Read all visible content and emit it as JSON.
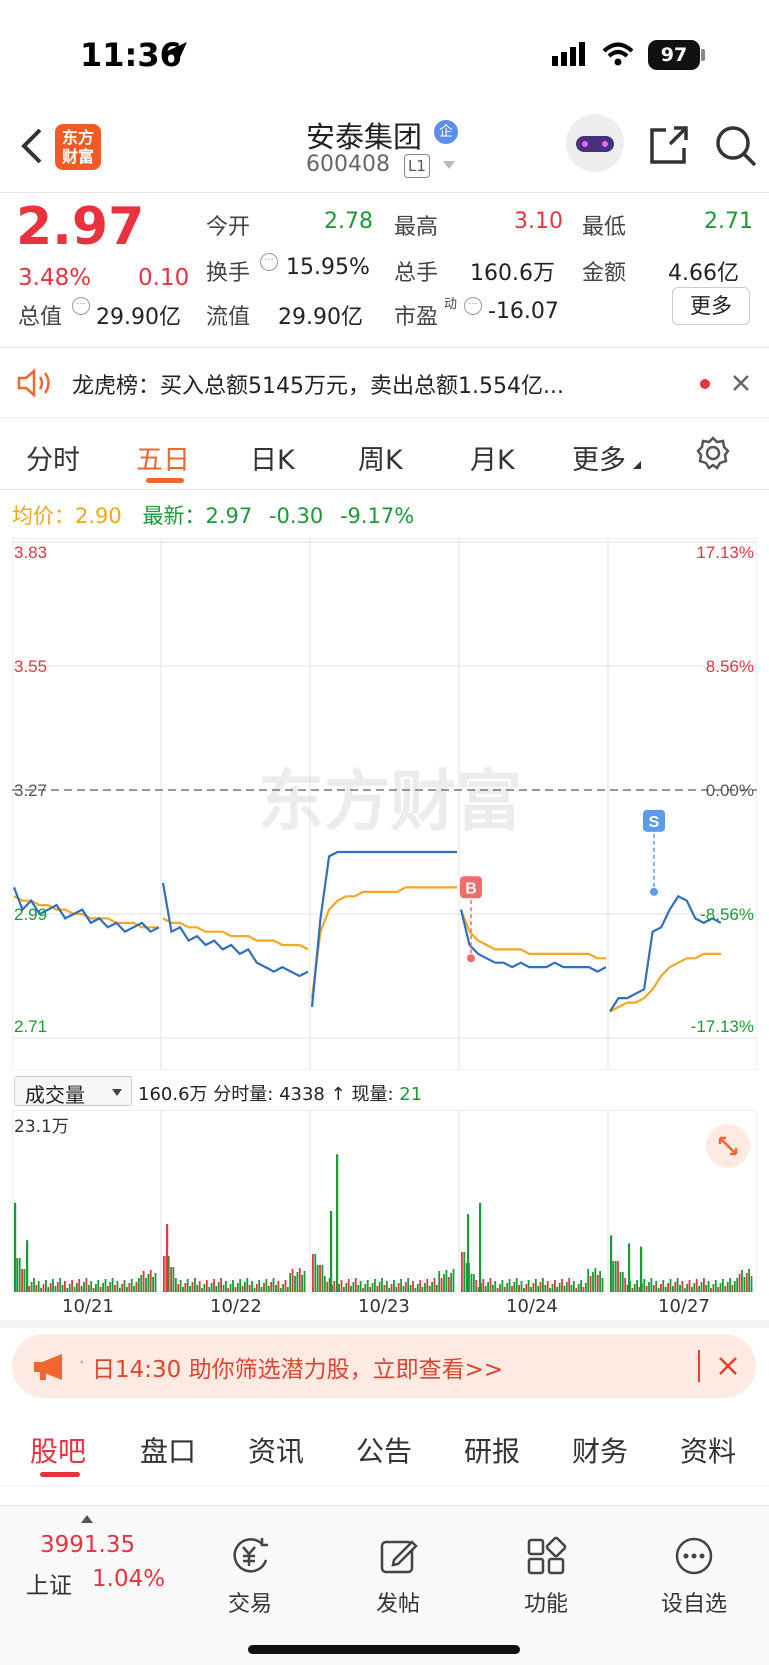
{
  "status": {
    "time": "11:36",
    "battery": "97"
  },
  "header": {
    "title": "安泰集团",
    "badge": "企",
    "code": "600408",
    "level": "L1",
    "logo_line1": "东方",
    "logo_line2": "财富"
  },
  "quote": {
    "price": "2.97",
    "change_pct": "3.48%",
    "change": "0.10",
    "fields": [
      {
        "label": "今开",
        "value": "2.78",
        "color": "green"
      },
      {
        "label": "最高",
        "value": "3.10",
        "color": "red"
      },
      {
        "label": "最低",
        "value": "2.71",
        "color": "green"
      },
      {
        "label": "换手",
        "value": "15.95%",
        "color": "black"
      },
      {
        "label": "总手",
        "value": "160.6万",
        "color": "black"
      },
      {
        "label": "金额",
        "value": "4.66亿",
        "color": "black"
      },
      {
        "label": "总值",
        "value": "29.90亿",
        "color": "black"
      },
      {
        "label": "流值",
        "value": "29.90亿",
        "color": "black"
      },
      {
        "label": "市盈",
        "value": "-16.07",
        "color": "black"
      }
    ],
    "pe_sup": "动",
    "more": "更多"
  },
  "notice": {
    "text": "龙虎榜：买入总额5145万元，卖出总额1.554亿..."
  },
  "tabs": [
    "分时",
    "五日",
    "日K",
    "周K",
    "月K",
    "更多"
  ],
  "active_tab": "五日",
  "info": {
    "avg_label": "均价：",
    "avg": "2.90",
    "latest_label": "最新：",
    "latest": "2.97",
    "chg": "-0.30",
    "chg_pct": "-9.17%"
  },
  "watermark": "东方财富",
  "volume": {
    "selector": "成交量",
    "total": "160.6万",
    "tick_label": "分时量:",
    "tick": "4338",
    "arrow": "↑",
    "now_label": "现量:",
    "now": "21",
    "max": "23.1万"
  },
  "banner": {
    "text": "日14:30 助你筛选潜力股，立即查看>>",
    "prefix": "·"
  },
  "bottom_tabs": [
    "股吧",
    "盘口",
    "资讯",
    "公告",
    "研报",
    "财务",
    "资料"
  ],
  "bottom_nav": {
    "index_value": "3991.35",
    "index_name": "上证",
    "index_pct": "1.04%",
    "items": [
      {
        "label": "交易",
        "icon": "trade-icon"
      },
      {
        "label": "发帖",
        "icon": "post-icon"
      },
      {
        "label": "功能",
        "icon": "apps-icon"
      },
      {
        "label": "设自选",
        "icon": "more-icon"
      }
    ]
  },
  "chart_data": {
    "type": "line",
    "x_labels": [
      "10/21",
      "10/22",
      "10/23",
      "10/24",
      "10/27"
    ],
    "y_left": [
      "3.83",
      "3.55",
      "3.27",
      "2.99",
      "2.71"
    ],
    "y_right": [
      "17.13%",
      "8.56%",
      "0.00%",
      "-8.56%",
      "-17.13%"
    ],
    "ylim": [
      2.71,
      3.83
    ],
    "prev_close": 3.27,
    "series": [
      {
        "name": "最新",
        "color": "#2f6fbf",
        "values": [
          [
            3.05,
            3.0,
            3.02,
            2.99,
            3.0,
            3.01,
            2.98,
            2.99,
            3.0,
            2.97,
            2.98,
            2.96,
            2.97,
            2.95,
            2.96,
            2.97,
            2.95,
            2.96
          ],
          [
            3.06,
            2.95,
            2.96,
            2.93,
            2.94,
            2.92,
            2.93,
            2.91,
            2.92,
            2.9,
            2.91,
            2.88,
            2.87,
            2.86,
            2.87,
            2.86,
            2.85,
            2.86
          ],
          [
            2.78,
            2.98,
            3.12,
            3.13,
            3.13,
            3.13,
            3.13,
            3.13,
            3.13,
            3.13,
            3.13,
            3.13,
            3.13,
            3.13,
            3.13,
            3.13,
            3.13,
            3.13
          ],
          [
            3.0,
            2.92,
            2.9,
            2.89,
            2.88,
            2.88,
            2.87,
            2.88,
            2.87,
            2.87,
            2.87,
            2.88,
            2.87,
            2.87,
            2.87,
            2.87,
            2.86,
            2.87
          ],
          [
            2.77,
            2.8,
            2.8,
            2.81,
            2.82,
            2.95,
            2.96,
            3.0,
            3.03,
            3.02,
            2.98,
            2.97,
            2.98,
            2.97
          ]
        ]
      },
      {
        "name": "均价",
        "color": "#f5a623",
        "values": [
          [
            3.03,
            3.02,
            3.02,
            3.01,
            3.01,
            3.0,
            3.0,
            2.99,
            2.99,
            2.98,
            2.98,
            2.98,
            2.97,
            2.97,
            2.97,
            2.96,
            2.96,
            2.96
          ],
          [
            2.98,
            2.97,
            2.97,
            2.96,
            2.96,
            2.95,
            2.95,
            2.95,
            2.94,
            2.94,
            2.94,
            2.93,
            2.93,
            2.93,
            2.92,
            2.92,
            2.92,
            2.91
          ],
          [
            2.8,
            2.95,
            3.0,
            3.02,
            3.03,
            3.03,
            3.04,
            3.04,
            3.04,
            3.04,
            3.04,
            3.05,
            3.05,
            3.05,
            3.05,
            3.05,
            3.05,
            3.05
          ],
          [
            3.0,
            2.95,
            2.93,
            2.92,
            2.91,
            2.91,
            2.91,
            2.91,
            2.9,
            2.9,
            2.9,
            2.9,
            2.9,
            2.9,
            2.9,
            2.9,
            2.89,
            2.89
          ],
          [
            2.77,
            2.78,
            2.79,
            2.79,
            2.8,
            2.82,
            2.85,
            2.87,
            2.88,
            2.89,
            2.89,
            2.9,
            2.9,
            2.9
          ]
        ]
      }
    ],
    "markers": [
      {
        "label": "B",
        "day": 3,
        "value": 2.89
      },
      {
        "label": "S",
        "day": 4,
        "value": 3.04
      }
    ],
    "volume_max": "23.1万"
  }
}
